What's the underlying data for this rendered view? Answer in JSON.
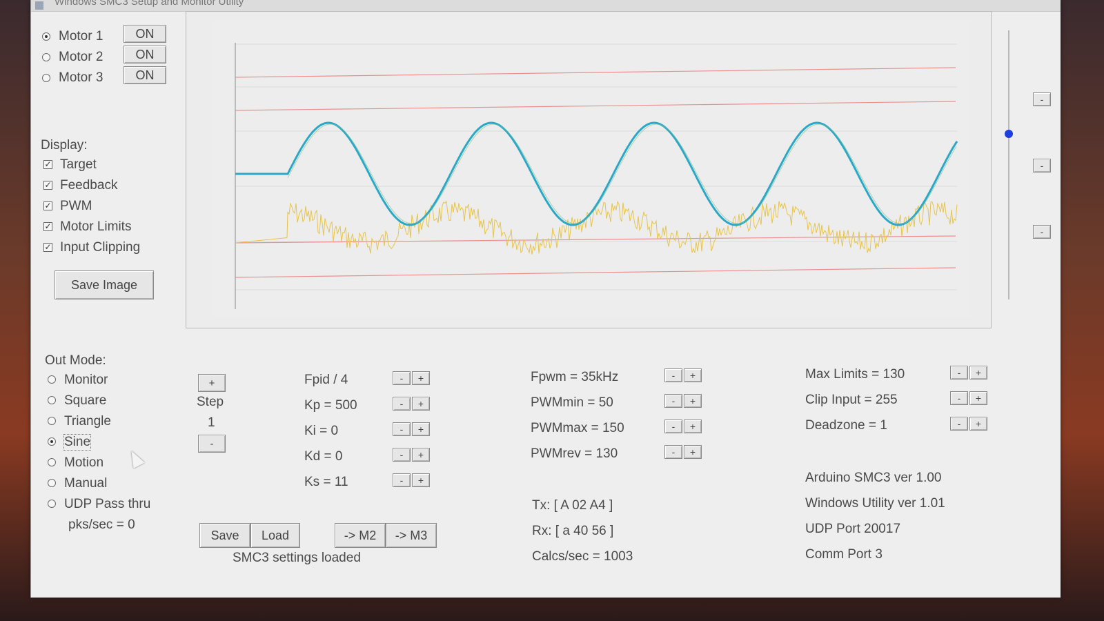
{
  "window": {
    "title": "Windows SMC3 Setup and Monitor Utility"
  },
  "motors": [
    {
      "label": "Motor 1",
      "button": "ON",
      "selected": true
    },
    {
      "label": "Motor 2",
      "button": "ON",
      "selected": false
    },
    {
      "label": "Motor 3",
      "button": "ON",
      "selected": false
    }
  ],
  "display": {
    "heading": "Display:",
    "options": [
      {
        "label": "Target",
        "checked": true
      },
      {
        "label": "Feedback",
        "checked": true
      },
      {
        "label": "PWM",
        "checked": true
      },
      {
        "label": "Motor Limits",
        "checked": true
      },
      {
        "label": "Input Clipping",
        "checked": true
      }
    ],
    "save_image": "Save Image"
  },
  "out_mode": {
    "heading": "Out Mode:",
    "options": [
      {
        "label": "Monitor",
        "selected": false
      },
      {
        "label": "Square",
        "selected": false
      },
      {
        "label": "Triangle",
        "selected": false
      },
      {
        "label": "Sine",
        "selected": true
      },
      {
        "label": "Motion",
        "selected": false
      },
      {
        "label": "Manual",
        "selected": false
      },
      {
        "label": "UDP Pass thru",
        "selected": false
      }
    ],
    "pks": "pks/sec = 0"
  },
  "step": {
    "plus": "+",
    "label": "Step",
    "value": "1",
    "minus": "-"
  },
  "pid_params": [
    {
      "label": "Fpid / 4"
    },
    {
      "label": "Kp = 500"
    },
    {
      "label": "Ki = 0"
    },
    {
      "label": "Kd = 0"
    },
    {
      "label": "Ks = 11"
    }
  ],
  "pwm_params": [
    {
      "label": "Fpwm = 35kHz"
    },
    {
      "label": "PWMmin = 50"
    },
    {
      "label": "PWMmax = 150"
    },
    {
      "label": "PWMrev = 130"
    }
  ],
  "limit_params": [
    {
      "label": "Max Limits = 130"
    },
    {
      "label": "Clip Input = 255"
    },
    {
      "label": "Deadzone = 1"
    }
  ],
  "spin_labels": {
    "minus": "-",
    "plus": "+"
  },
  "actions": {
    "save": "Save",
    "load": "Load",
    "to_m2": "-> M2",
    "to_m3": "-> M3"
  },
  "status_text": "SMC3 settings loaded",
  "comms": {
    "tx": "Tx: [ A 02 A4 ]",
    "rx": "Rx: [ a 40 56 ]",
    "calcs": "Calcs/sec = 1003"
  },
  "info": {
    "arduino": "Arduino SMC3 ver 1.00",
    "windows": "Windows Utility ver 1.01",
    "udp": "UDP Port 20017",
    "comm": "Comm Port 3"
  },
  "side_buttons": [
    "-",
    "-",
    "-"
  ],
  "colors": {
    "target": "#2aa8c8",
    "pwm": "#e6c44a",
    "limits": "#ec8f8f",
    "knob": "#1e3fe0"
  },
  "chart_data": {
    "type": "line",
    "series": [
      {
        "values": "sine wave, 4.5 cycles after start"
      },
      {
        "values": "noisy pwm trace"
      }
    ]
  }
}
